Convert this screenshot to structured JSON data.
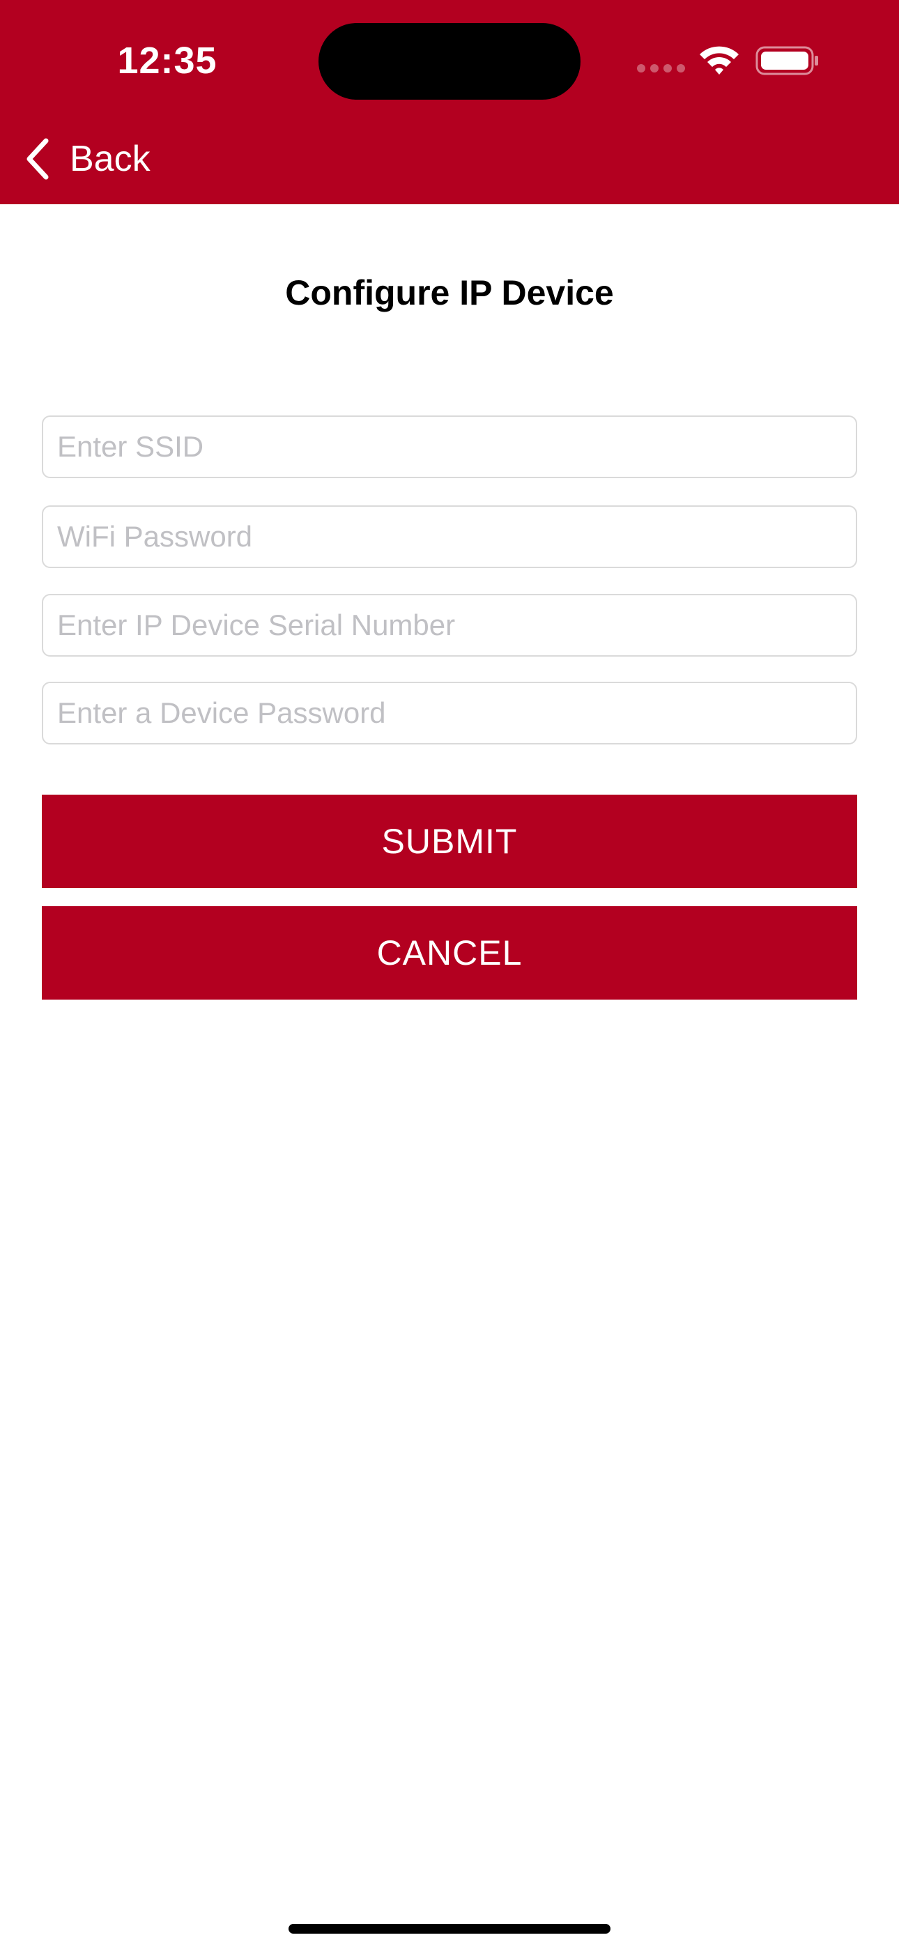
{
  "status_bar": {
    "time": "12:35"
  },
  "nav": {
    "back_label": "Back"
  },
  "page": {
    "title": "Configure IP Device"
  },
  "form": {
    "ssid": {
      "value": "",
      "placeholder": "Enter SSID"
    },
    "wifi_password": {
      "value": "",
      "placeholder": "WiFi Password"
    },
    "serial_number": {
      "value": "",
      "placeholder": "Enter IP Device Serial Number"
    },
    "device_password": {
      "value": "",
      "placeholder": "Enter a Device Password"
    }
  },
  "actions": {
    "submit_label": "SUBMIT",
    "cancel_label": "CANCEL"
  },
  "icons": {
    "back": "chevron-left-icon",
    "signal": "cellular-signal-icon",
    "wifi": "wifi-icon",
    "battery": "battery-icon"
  },
  "colors": {
    "brand": "#b30020",
    "background": "#ffffff",
    "placeholder": "#c0c0c4",
    "field_border": "#dadada"
  }
}
